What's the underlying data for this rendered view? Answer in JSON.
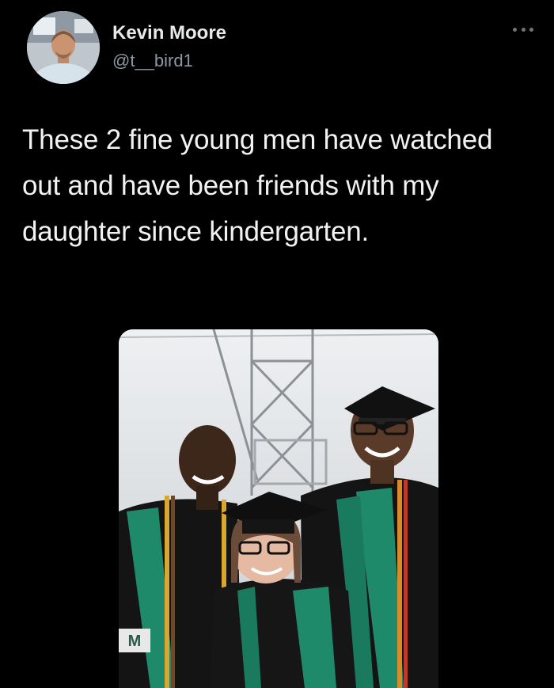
{
  "tweet": {
    "author": {
      "display_name": "Kevin Moore",
      "handle": "@t__bird1",
      "avatar_icon": "profile-photo"
    },
    "more_icon": "more-options-icon",
    "text": "These 2 fine young men have watched out and have been friends with my daughter since kindergarten.",
    "media": {
      "type": "photo",
      "banner_logo_text": "M"
    }
  },
  "colors": {
    "background": "#000000",
    "primary_text": "#e7e9ea",
    "secondary_text": "#8b98a5",
    "gown": "#151515",
    "stole": "#1f8a6a"
  }
}
